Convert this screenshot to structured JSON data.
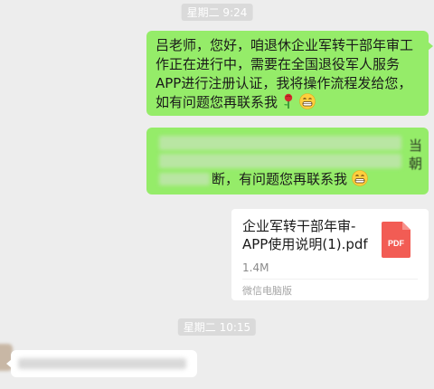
{
  "timestamps": [
    "星期二 9:24",
    "星期二 10:15"
  ],
  "messages": {
    "first": {
      "text": "吕老师，您好，咱退休企业军转干部年审工作正在进行中，需要在全国退役军人服务APP进行注册认证，我将操作流程发给您，如有问题您再联系我",
      "emoji": [
        "rose",
        "grinning"
      ]
    },
    "second": {
      "visible_end": "断，有问题您再联系我",
      "edge_chars": [
        "当",
        "朝"
      ]
    }
  },
  "file": {
    "name": "企业军转干部年审-APP使用说明(1).pdf",
    "size": "1.4M",
    "source": "微信电脑版",
    "icon_label": "PDF",
    "icon_color": "#f25c54"
  },
  "colors": {
    "outgoing_bubble": "#95ec69",
    "background": "#ededed"
  }
}
